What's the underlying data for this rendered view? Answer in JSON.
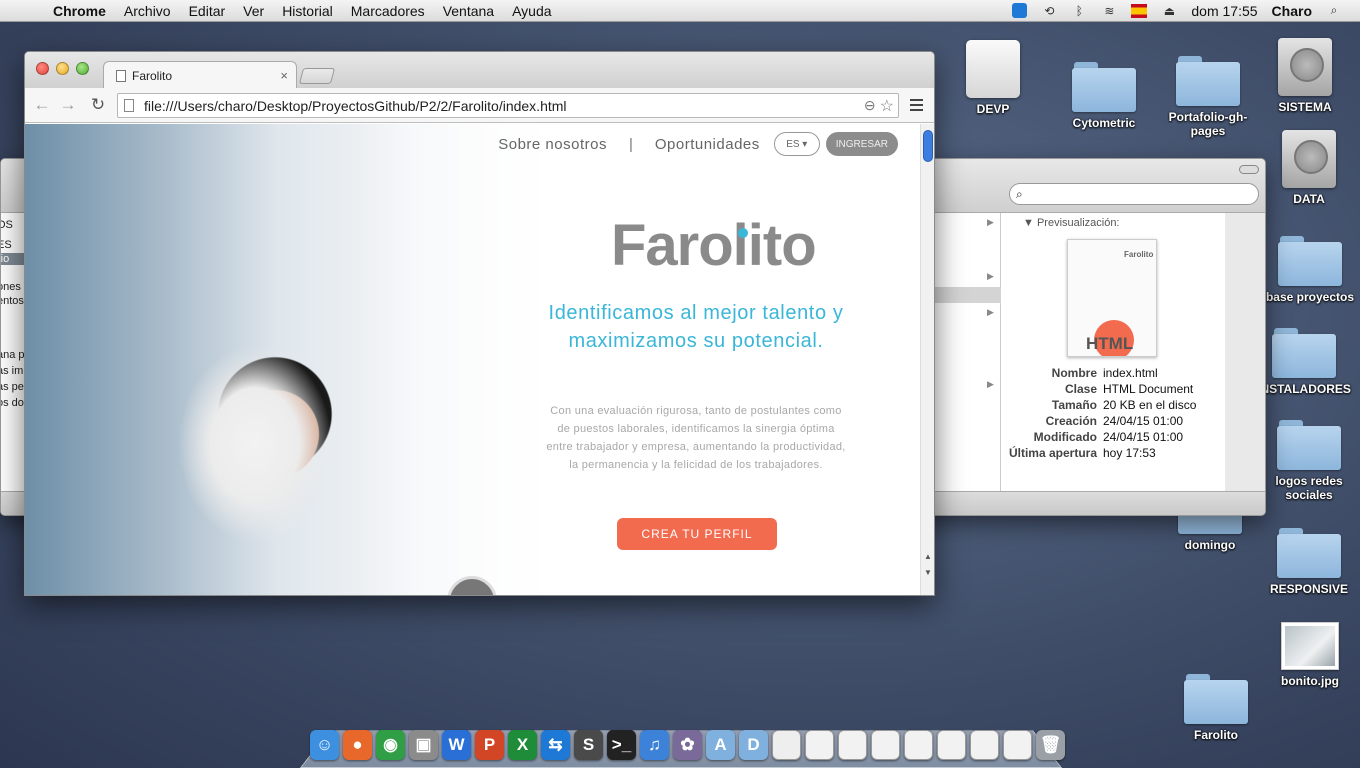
{
  "menubar": {
    "app_name": "Chrome",
    "items": [
      "Archivo",
      "Editar",
      "Ver",
      "Historial",
      "Marcadores",
      "Ventana",
      "Ayuda"
    ],
    "flag_label": "ISO",
    "clock": "dom 17:55",
    "user": "Charo"
  },
  "desktop": {
    "icons": [
      {
        "label": "DEVP",
        "icon": "drive-icon"
      },
      {
        "label": "Cytometric",
        "icon": "folder-icon"
      },
      {
        "label": "Portafolio-gh-pages",
        "icon": "folder-icon"
      },
      {
        "label": "SISTEMA",
        "icon": "disk-icon"
      },
      {
        "label": "DATA",
        "icon": "disk-icon"
      },
      {
        "label": "base proyectos",
        "icon": "folder-icon"
      },
      {
        "label": "INSTALADORES",
        "icon": "folder-icon"
      },
      {
        "label": "logos redes sociales",
        "icon": "folder-icon"
      },
      {
        "label": "domingo",
        "icon": "folder-icon"
      },
      {
        "label": "RESPONSIVE",
        "icon": "folder-icon"
      },
      {
        "label": "bonito.jpg",
        "icon": "image-icon"
      },
      {
        "label": "Farolito",
        "icon": "folder-icon"
      }
    ]
  },
  "finder": {
    "left_fragments": [
      "OS",
      "ES",
      "rio",
      "ones",
      "entos",
      "ana p",
      "as im",
      "as pe",
      "os do"
    ],
    "preview_header": "Previsualización:",
    "thumb_logo": "Farolito",
    "thumb_badge": "HTML",
    "meta": [
      {
        "key": "Nombre",
        "value": "index.html"
      },
      {
        "key": "Clase",
        "value": "HTML Document"
      },
      {
        "key": "Tamaño",
        "value": "20 KB en el disco"
      },
      {
        "key": "Creación",
        "value": "24/04/15 01:00"
      },
      {
        "key": "Modificado",
        "value": "24/04/15 01:00"
      },
      {
        "key": "Última apertura",
        "value": "hoy 17:53"
      }
    ]
  },
  "chrome": {
    "tab_title": "Farolito",
    "url": "file:///Users/charo/Desktop/ProyectosGithub/P2/2/Farolito/index.html"
  },
  "site": {
    "nav": {
      "about": "Sobre nosotros",
      "separator": "|",
      "opportunities": "Oportunidades",
      "lang": "ES ▾",
      "login": "INGRESAR"
    },
    "brand": "Farolito",
    "tagline": "Identificamos al mejor talento y maximizamos su potencial.",
    "description": "Con una evaluación rigurosa, tanto de postulantes como de puestos laborales, identificamos la sinergia óptima entre trabajador y empresa, aumentando la productividad, la permanencia y la felicidad de los trabajadores.",
    "cta": "CREA TU PERFIL",
    "colors": {
      "accent": "#3ab6d8",
      "cta": "#f26b4f",
      "brand_gray": "#8a8a8a"
    }
  },
  "dock": {
    "apps": [
      "finder-icon",
      "firefox-icon",
      "chrome-icon",
      "preview-icon",
      "word-icon",
      "powerpoint-icon",
      "excel-icon",
      "teamviewer-icon",
      "sublime-icon",
      "terminal-icon",
      "itunes-icon",
      "photos-icon",
      "applications-folder-icon",
      "documents-folder-icon",
      "file-icon",
      "screenshot-icon",
      "screenshot-icon",
      "screenshot-icon",
      "screenshot-icon",
      "screenshot-icon",
      "screenshot-icon",
      "screenshot-icon",
      "trash-icon"
    ]
  }
}
